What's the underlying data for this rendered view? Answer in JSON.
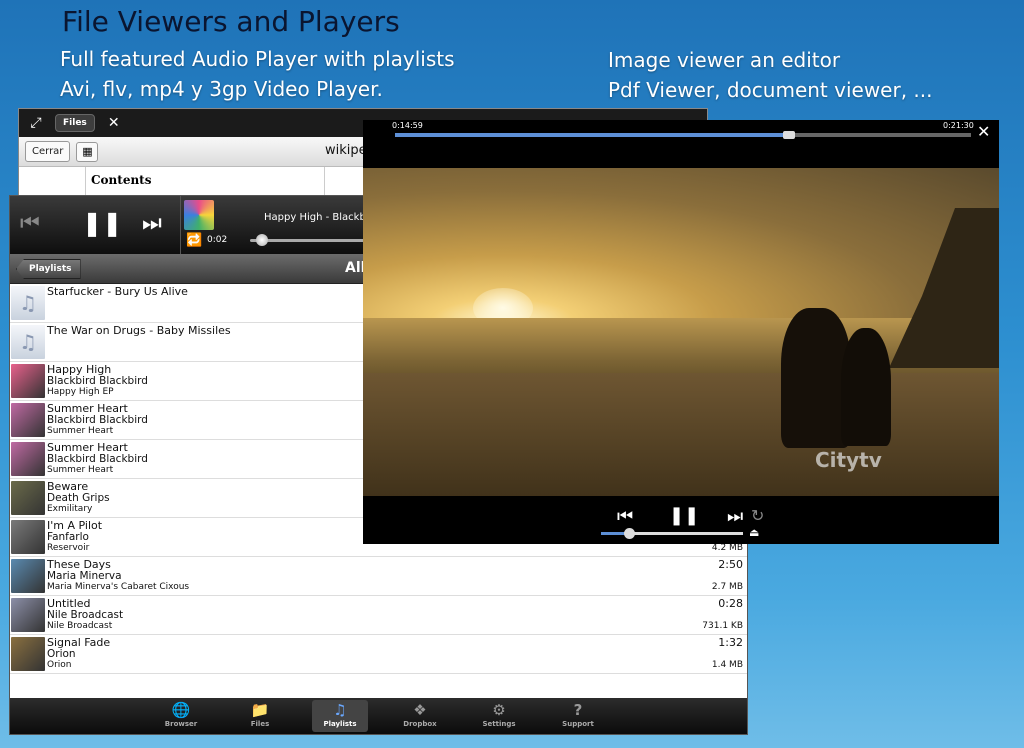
{
  "promo": {
    "title": "File Viewers and Players",
    "audio_line1": "Full featured Audio Player with playlists",
    "audio_line2": "Avi, flv, mp4 y 3gp Video Player.",
    "image_line1": "Image viewer an editor",
    "image_line2": "Pdf Viewer, document viewer, ..."
  },
  "browser": {
    "files_label": "Files",
    "close_label": "Cerrar",
    "site_text": "wikiped",
    "contents_heading": "Contents"
  },
  "audio": {
    "now_playing_title": "Happy High - Blackbird",
    "elapsed": "0:02",
    "playlists_label": "Playlists",
    "nav_title": "All",
    "tracks": [
      {
        "title": "Starfucker - Bury Us Alive",
        "artist": "",
        "album": "",
        "duration": "",
        "size": "",
        "cover": "note"
      },
      {
        "title": "The War on Drugs - Baby Missiles",
        "artist": "",
        "album": "",
        "duration": "",
        "size": "",
        "cover": "note"
      },
      {
        "title": "Happy High",
        "artist": "Blackbird Blackbird",
        "album": "Happy High EP",
        "duration": "",
        "size": "",
        "cover": "#e8618c"
      },
      {
        "title": "Summer Heart",
        "artist": "Blackbird Blackbird",
        "album": "Summer Heart",
        "duration": "",
        "size": "",
        "cover": "#c06aa3"
      },
      {
        "title": "Summer Heart",
        "artist": "Blackbird Blackbird",
        "album": "Summer Heart",
        "duration": "",
        "size": "",
        "cover": "#c06aa3"
      },
      {
        "title": "Beware",
        "artist": "Death Grips",
        "album": "Exmilitary",
        "duration": "",
        "size": "",
        "cover": "#6b6b4a"
      },
      {
        "title": "I'm A Pilot",
        "artist": "Fanfarlo",
        "album": "Reservoir",
        "duration": "",
        "size": "4.2 MB",
        "cover": "#7a7a7a"
      },
      {
        "title": "These Days",
        "artist": "Maria Minerva",
        "album": "Maria Minerva's Cabaret Cixous",
        "duration": "2:50",
        "size": "2.7 MB",
        "cover": "#5a8ab0"
      },
      {
        "title": "Untitled",
        "artist": "Nile Broadcast",
        "album": "Nile Broadcast",
        "duration": "0:28",
        "size": "731.1 KB",
        "cover": "#8c8fa8"
      },
      {
        "title": "Signal Fade",
        "artist": "Orion",
        "album": "Orion",
        "duration": "1:32",
        "size": "1.4 MB",
        "cover": "#8a7040"
      }
    ],
    "tabs": [
      {
        "label": "Browser",
        "icon": "globe-icon"
      },
      {
        "label": "Files",
        "icon": "folder-icon"
      },
      {
        "label": "Playlists",
        "icon": "music-note-icon",
        "active": true
      },
      {
        "label": "Dropbox",
        "icon": "dropbox-icon"
      },
      {
        "label": "Settings",
        "icon": "gear-icon"
      },
      {
        "label": "Support",
        "icon": "question-icon"
      }
    ]
  },
  "video": {
    "elapsed": "0:14:59",
    "remaining": "0:21:30",
    "progress_fraction": 0.68,
    "volume_fraction": 0.2,
    "watermark": "Citytv"
  }
}
